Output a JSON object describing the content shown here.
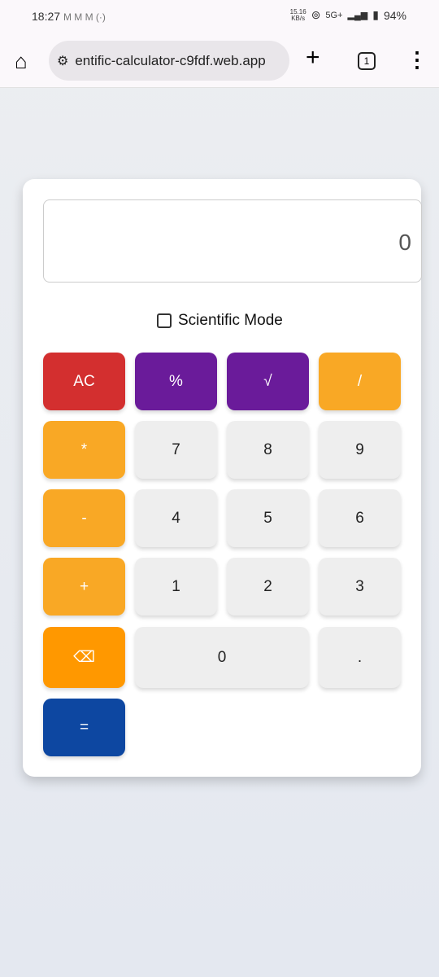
{
  "status": {
    "time": "18:27",
    "icons": "M M M (·)",
    "speed": "15.16",
    "speed_unit": "KB/s",
    "network": "5G+",
    "battery": "94%"
  },
  "browser": {
    "url": "entific-calculator-c9fdf.web.app",
    "tab_count": "1"
  },
  "calculator": {
    "display": "0",
    "mode_label": "Scientific Mode",
    "mode_checked": false,
    "buttons": {
      "ac": "AC",
      "percent": "%",
      "sqrt": "√",
      "divide": "/",
      "multiply": "*",
      "seven": "7",
      "eight": "8",
      "nine": "9",
      "minus": "-",
      "four": "4",
      "five": "5",
      "six": "6",
      "plus": "+",
      "one": "1",
      "two": "2",
      "three": "3",
      "backspace": "⌫",
      "zero": "0",
      "dot": ".",
      "equals": "="
    }
  },
  "colors": {
    "clear": "#d32f2f",
    "function": "#6a1b9a",
    "operator": "#f9a825",
    "backspace": "#ff9800",
    "equals": "#0d47a1",
    "number": "#eeeeee"
  }
}
